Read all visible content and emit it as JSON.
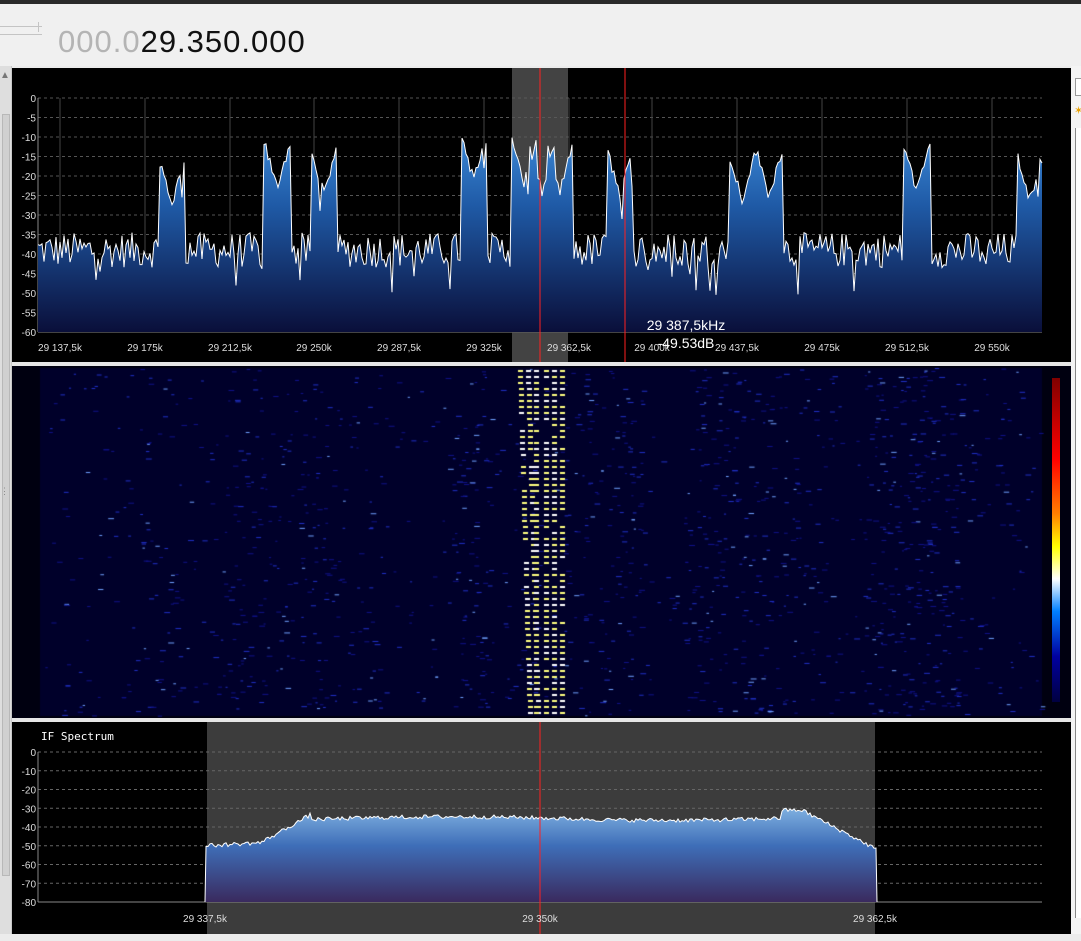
{
  "frequency_display": {
    "dim_digits": "000.0",
    "active_digits": "29.350.000"
  },
  "colors": {
    "plot_background": "#000000",
    "grid": "#555555",
    "spectrum_fill": "#1f5aa6",
    "trace": "#ffffff",
    "center_marker": "#ff2020",
    "selection": "#5a5a5a",
    "waterfall_bg": "#00002a",
    "waterfall_signal": "#ffff80"
  },
  "spectrum": {
    "y_ticks": [
      "0",
      "-5",
      "-10",
      "-15",
      "-20",
      "-25",
      "-30",
      "-35",
      "-40",
      "-45",
      "-50",
      "-55",
      "-60"
    ],
    "x_ticks": [
      "29 137,5k",
      "29 175k",
      "29 212,5k",
      "29 250k",
      "29 287,5k",
      "29 325k",
      "29 362,5k",
      "29 400k",
      "29 437,5k",
      "29 475k",
      "29 512,5k",
      "29 550k"
    ],
    "hover": {
      "freq": "29 387,5kHz",
      "level": "-49.53dB"
    }
  },
  "waterfall": {
    "colorbar": [
      "#ffffff",
      "#ffff00",
      "#ff8000",
      "#ff0000",
      "#7f0000",
      "#000060",
      "#0000ff"
    ]
  },
  "if_spectrum": {
    "title": "IF Spectrum",
    "y_ticks": [
      "0",
      "-10",
      "-20",
      "-30",
      "-40",
      "-50",
      "-60",
      "-70",
      "-80"
    ],
    "x_ticks": [
      "29 337,5k",
      "29 350k",
      "29 362,5k"
    ]
  }
}
